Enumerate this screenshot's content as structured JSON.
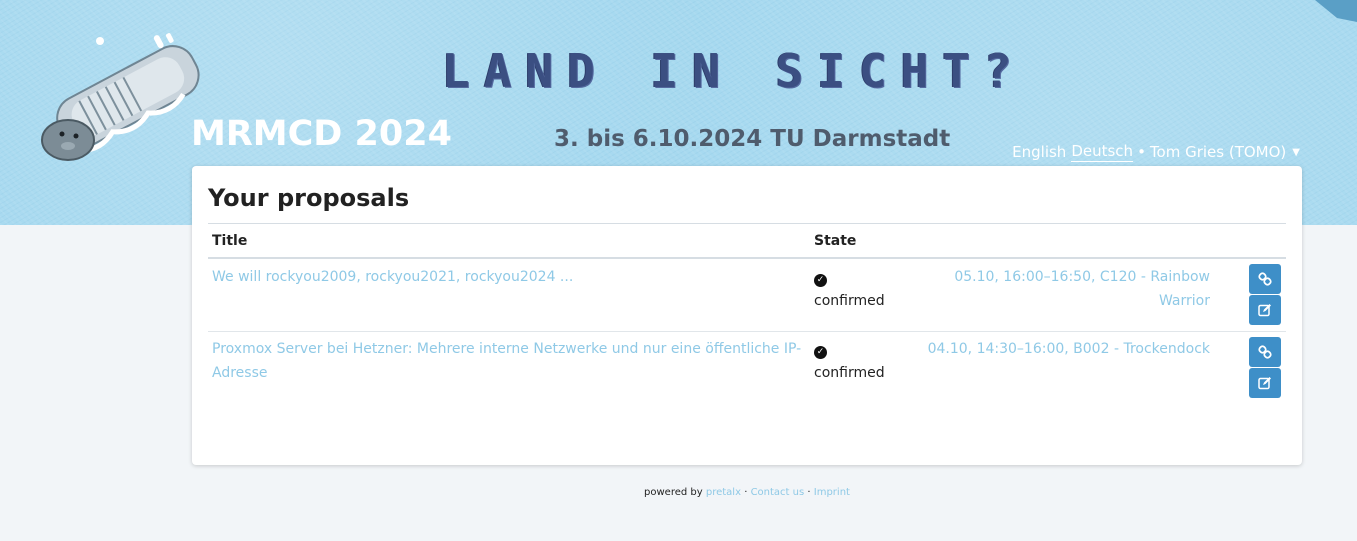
{
  "header": {
    "tagline": "LAND IN SICHT?",
    "dates": "3. bis 6.10.2024 TU Darmstadt",
    "event_name": "MRMCD 2024"
  },
  "user_nav": {
    "lang_en": "English",
    "lang_de": "Deutsch",
    "separator": "•",
    "user_name": "Tom Gries (TOMO)"
  },
  "page": {
    "title": "Your proposals",
    "col_title": "Title",
    "col_state": "State"
  },
  "proposals": [
    {
      "title": "We will rockyou2009, rockyou2021, rockyou2024 ...",
      "state": "confirmed",
      "slot": "05.10, 16:00–16:50, C120 - Rainbow Warrior"
    },
    {
      "title": "Proxmox Server bei Hetzner: Mehrere interne Netzwerke und nur eine öffentliche IP-Adresse",
      "state": "confirmed",
      "slot": "04.10, 14:30–16:00, B002 - Trockendock"
    }
  ],
  "footer": {
    "powered_by": "powered by",
    "pretalx": "pretalx",
    "dot": "·",
    "contact": "Contact us",
    "imprint": "Imprint"
  },
  "colors": {
    "header_bg": "#a4d8ef",
    "link": "#8fc9e6",
    "button": "#3e8fc8",
    "page_bg": "#f2f5f8"
  },
  "icons": [
    "mascot-logo-icon",
    "check-circle-icon",
    "link-icon",
    "edit-icon",
    "caret-down-icon"
  ]
}
